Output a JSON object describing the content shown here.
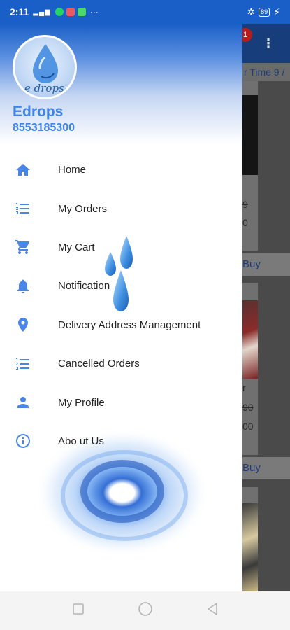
{
  "status_bar": {
    "time": "2:11",
    "signal": "4G",
    "battery": "89"
  },
  "drawer": {
    "logo_text": "e drops",
    "user_name": "Edrops",
    "phone": "8553185300",
    "items": [
      {
        "label": "Home",
        "icon": "home-icon"
      },
      {
        "label": "My Orders",
        "icon": "list-icon"
      },
      {
        "label": "My Cart",
        "icon": "cart-icon"
      },
      {
        "label": "Notification",
        "icon": "bell-icon"
      },
      {
        "label": "Delivery Address Management",
        "icon": "location-pin-icon"
      },
      {
        "label": "Cancelled Orders",
        "icon": "list-icon"
      },
      {
        "label": "My Profile",
        "icon": "person-icon"
      },
      {
        "label": "Abo ut Us",
        "icon": "info-icon"
      }
    ]
  },
  "background_app": {
    "cart_badge": "1",
    "strip_text": "r Time 9 /",
    "card1_price_old": "9",
    "card1_price_new": "0",
    "buy_label": "Buy",
    "card2_title": "r",
    "card2_price_old": "90",
    "card2_price_new": "00"
  },
  "colors": {
    "primary": "#1a5fc7",
    "accent": "#3f84e6",
    "icon": "#4a86e8"
  }
}
